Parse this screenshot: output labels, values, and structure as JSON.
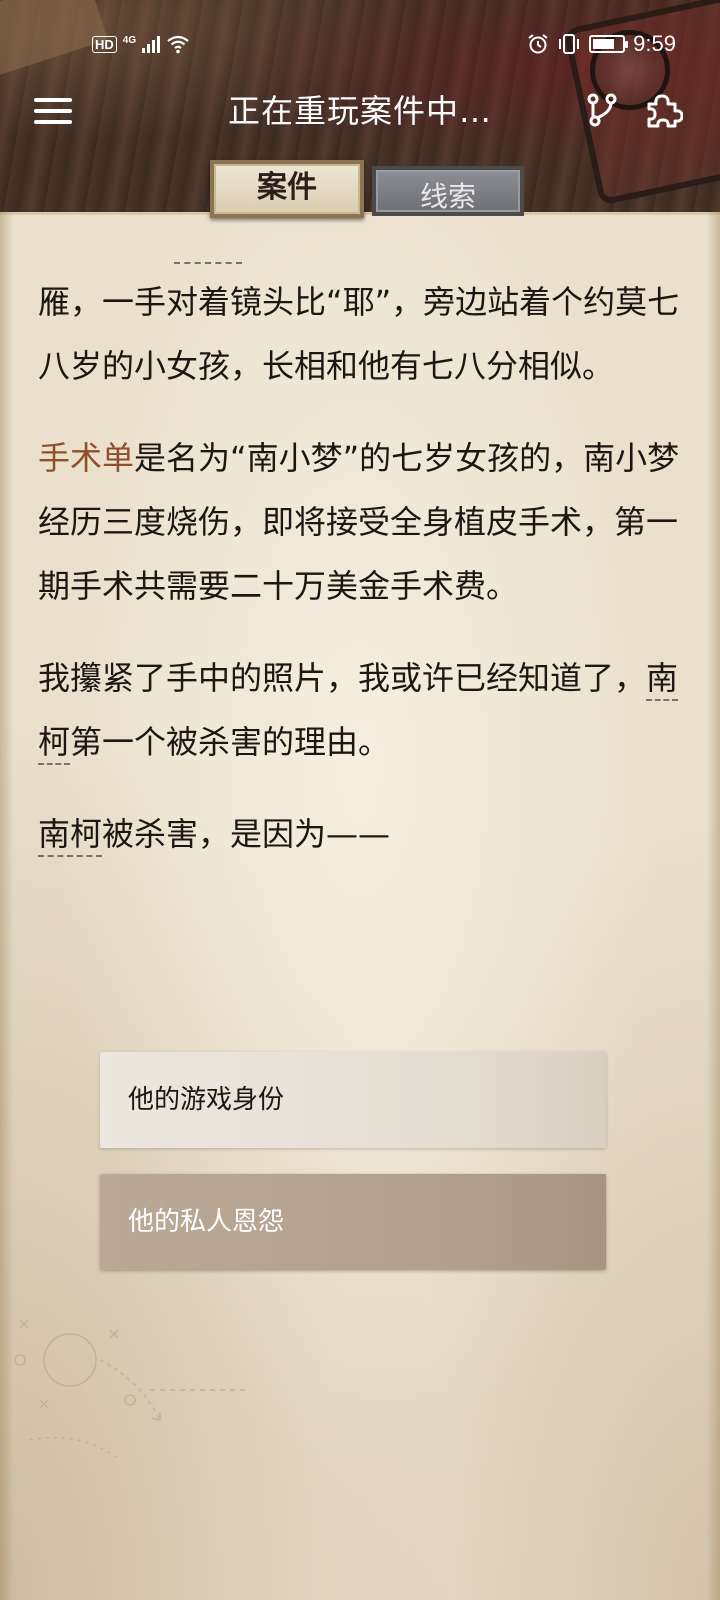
{
  "status_bar": {
    "hd": "HD",
    "network": "4G",
    "time": "9:59",
    "battery_level": 0.75
  },
  "nav": {
    "title": "正在重玩案件中…",
    "menu_icon": "hamburger-menu-icon",
    "branch_icon": "branch-icon",
    "puzzle_icon": "puzzle-icon"
  },
  "tabs": [
    {
      "label": "案件",
      "active": true
    },
    {
      "label": "线索",
      "active": false
    }
  ],
  "story": {
    "p1": {
      "text": "雁，一手对着镜头比“耶”，旁边站着个约莫七八岁的小女孩，长相和他有七八分相似。"
    },
    "p2": {
      "highlight": "手术单",
      "rest": "是名为“南小梦”的七岁女孩的，南小梦经历三度烧伤，即将接受全身植皮手术，第一期手术共需要二十万美金手术费。"
    },
    "p3": {
      "before": "我攥紧了手中的照片，我或许已经知道了，",
      "keyword": "南柯",
      "after": "第一个被杀害的理由。"
    },
    "p4": {
      "keyword": "南柯",
      "after": "被杀害，是因为——"
    }
  },
  "choices": [
    {
      "label": "他的游戏身份"
    },
    {
      "label": "他的私人恩怨"
    }
  ],
  "colors": {
    "highlight": "#8f4f2b",
    "paper": "#eae0cc",
    "choice_selected": "#b29f8b"
  }
}
